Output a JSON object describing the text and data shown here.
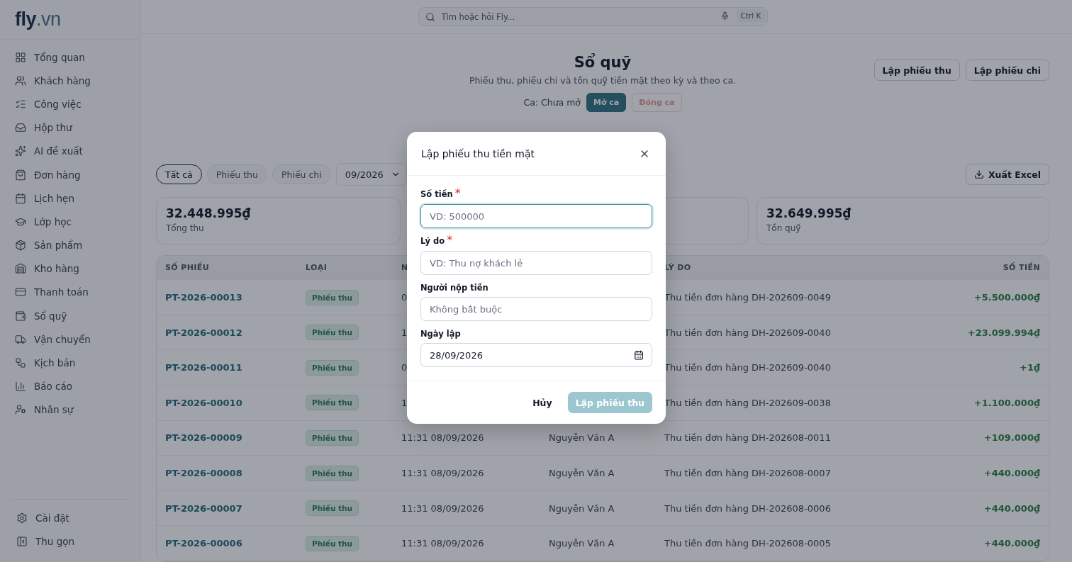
{
  "logo": {
    "main": "fly",
    "suffix": ".vn"
  },
  "sidebar": {
    "items": [
      {
        "label": "Tổng quan",
        "selected": false
      },
      {
        "label": "Khách hàng",
        "selected": false
      },
      {
        "label": "Công việc",
        "selected": false
      },
      {
        "label": "Hộp thư",
        "selected": false
      },
      {
        "label": "AI đề xuất",
        "selected": false
      },
      {
        "label": "Đơn hàng",
        "selected": false
      },
      {
        "label": "Lịch hẹn",
        "selected": false
      },
      {
        "label": "Lớp học",
        "selected": false
      },
      {
        "label": "Sản phẩm",
        "selected": false
      },
      {
        "label": "Kho hàng",
        "selected": false
      },
      {
        "label": "Thanh toán",
        "selected": false
      },
      {
        "label": "Sổ quỹ",
        "selected": false
      },
      {
        "label": "Vận chuyển",
        "selected": false
      },
      {
        "label": "Kịch bản",
        "selected": false
      },
      {
        "label": "Báo cáo",
        "selected": false
      },
      {
        "label": "Nhân sự",
        "selected": false
      }
    ],
    "footer": [
      {
        "label": "Cài đặt"
      },
      {
        "label": "Thu gọn"
      }
    ]
  },
  "search": {
    "placeholder": "Tìm hoặc hỏi Fly...",
    "shortcut": "Ctrl K"
  },
  "page": {
    "title": "Sổ quỹ",
    "subtitle": "Phiếu thu, phiếu chi và tồn quỹ tiền mặt theo kỳ và theo ca.",
    "shift_label": "Ca: Chưa mở",
    "shift_buttons": [
      {
        "label": "Mở ca",
        "kind": "primary",
        "disabled": false
      },
      {
        "label": "Đóng ca",
        "kind": "danger",
        "disabled": true
      }
    ],
    "actions": [
      "Lập phiếu thu",
      "Lập phiếu chi"
    ]
  },
  "filters": [
    {
      "label": "Tất cả",
      "selected": true
    },
    {
      "label": "Phiếu thu",
      "selected": false
    },
    {
      "label": "Phiếu chi",
      "selected": false
    }
  ],
  "month": "09/2026",
  "export": "Xuất Excel",
  "summary": [
    {
      "value": "32.448.995₫",
      "label": "Tổng thu"
    },
    {
      "value": "32.649.995₫",
      "label": "Tồn quỹ"
    }
  ],
  "table": {
    "columns": [
      "SỐ PHIẾU",
      "LOẠI",
      "N",
      "",
      "LÝ DO",
      "SỐ TIỀN"
    ],
    "rows": [
      [
        "PT-2026-00013",
        "Phiếu thu",
        "0",
        "",
        "Thu tiền đơn hàng DH-202609-0049",
        "+5.500.000₫"
      ],
      [
        "PT-2026-00012",
        "Phiếu thu",
        "1",
        "",
        "Thu tiền đơn hàng DH-202609-0040",
        "+23.099.994₫"
      ],
      [
        "PT-2026-00011",
        "Phiếu thu",
        "0",
        "",
        "Thu tiền đơn hàng DH-202609-0040",
        "+1₫"
      ],
      [
        "PT-2026-00010",
        "Phiếu thu",
        "1",
        "",
        "Thu tiền đơn hàng DH-202609-0038",
        "+1.100.000₫"
      ],
      [
        "PT-2026-00009",
        "Phiếu thu",
        "11:31 08/09/2026",
        "Nguyễn Văn A",
        "Thu tiền đơn hàng DH-202608-0011",
        "+109.000₫"
      ],
      [
        "PT-2026-00008",
        "Phiếu thu",
        "11:31 08/09/2026",
        "Nguyễn Văn A",
        "Thu tiền đơn hàng DH-202608-0007",
        "+440.000₫"
      ],
      [
        "PT-2026-00007",
        "Phiếu thu",
        "11:31 08/09/2026",
        "Nguyễn Văn A",
        "Thu tiền đơn hàng DH-202608-0006",
        "+440.000₫"
      ],
      [
        "PT-2026-00006",
        "Phiếu thu",
        "11:31 08/09/2026",
        "Nguyễn Văn A",
        "Thu tiền đơn hàng DH-202608-0005",
        "+440.000₫"
      ]
    ]
  },
  "dialog": {
    "title": "Lập phiếu thu tiền mặt",
    "fields": [
      {
        "label": "Số tiền",
        "marker": "*",
        "placeholder": "VD: 500000",
        "focused": true,
        "kind": "text"
      },
      {
        "label": "Lý do",
        "marker": "*",
        "placeholder": "VD: Thu nợ khách lẻ",
        "focused": false,
        "kind": "text"
      },
      {
        "label": "Người nộp tiền",
        "placeholder": "Không bắt buộc",
        "focused": false,
        "kind": "text"
      },
      {
        "label": "Ngày lập",
        "value": "28/09/2026",
        "focused": false,
        "kind": "date"
      }
    ],
    "cancel": "Hủy",
    "submit": {
      "label": "Lập phiếu thu",
      "disabled": true
    }
  }
}
